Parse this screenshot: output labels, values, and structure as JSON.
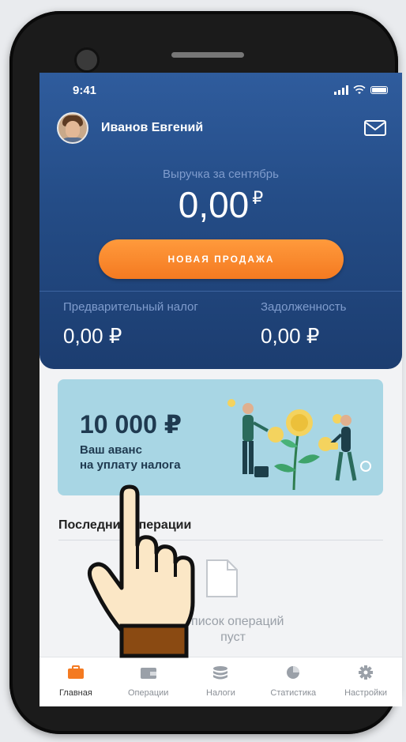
{
  "status_bar": {
    "time": "9:41"
  },
  "user": {
    "name": "Иванов Евгений"
  },
  "revenue": {
    "label": "Выручка за сентябрь",
    "value": "0,00",
    "currency": "₽"
  },
  "actions": {
    "new_sale_label": "НОВАЯ ПРОДАЖА"
  },
  "stats": {
    "prepayment_label": "Предварительный налог",
    "prepayment_value": "0,00 ₽",
    "debt_label": "Задолженность",
    "debt_value": "0,00 ₽"
  },
  "promo": {
    "amount": "10 000 ₽",
    "line1": "Ваш аванс",
    "line2": "на уплату налога"
  },
  "operations": {
    "title": "Последние операции",
    "empty_line1": "Список операций",
    "empty_line2": "пуст"
  },
  "tabs": [
    {
      "label": "Главная",
      "icon": "briefcase-icon",
      "active": true
    },
    {
      "label": "Операции",
      "icon": "wallet-icon",
      "active": false
    },
    {
      "label": "Налоги",
      "icon": "coins-stack-icon",
      "active": false
    },
    {
      "label": "Статистика",
      "icon": "pie-chart-icon",
      "active": false
    },
    {
      "label": "Настройки",
      "icon": "gear-icon",
      "active": false
    }
  ],
  "colors": {
    "header_blue": "#244c86",
    "accent_orange": "#f47a21",
    "promo_bg": "#a8d6e4"
  }
}
